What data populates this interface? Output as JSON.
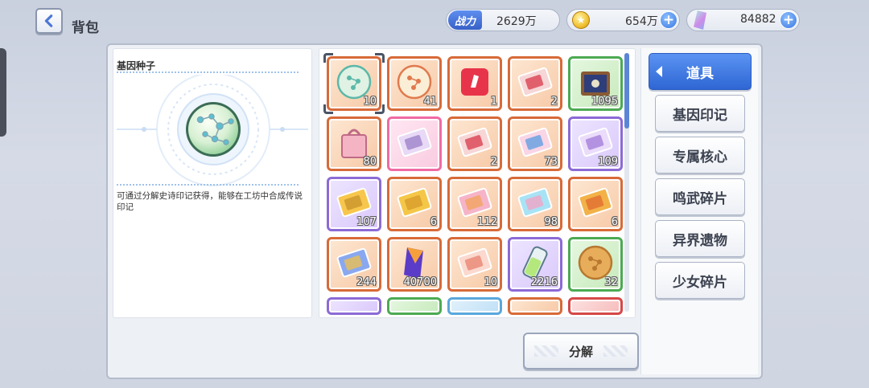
{
  "header": {
    "title": "背包",
    "power_label": "战力",
    "power_value": "2629万",
    "coin_value": "654万",
    "gem_value": "84882",
    "plus": "+"
  },
  "detail": {
    "name": "基因种子",
    "description": "可通过分解史诗印记获得，能够在工坊中合成传说印记"
  },
  "tabs": [
    {
      "label": "道具",
      "active": true
    },
    {
      "label": "基因印记",
      "active": false
    },
    {
      "label": "专属核心",
      "active": false
    },
    {
      "label": "鸣武碎片",
      "active": false
    },
    {
      "label": "异界遗物",
      "active": false
    },
    {
      "label": "少女碎片",
      "active": false
    }
  ],
  "items": [
    {
      "icon": "gene-seed-green-icon",
      "count": "10",
      "rarity": "orange",
      "selected": true
    },
    {
      "icon": "gene-seed-orange-icon",
      "count": "41",
      "rarity": "orange"
    },
    {
      "icon": "red-cube-icon",
      "count": "1",
      "rarity": "orange"
    },
    {
      "icon": "red-ticket-icon",
      "count": "2",
      "rarity": "orange"
    },
    {
      "icon": "treasure-chest-icon",
      "count": "1095",
      "rarity": "green"
    },
    {
      "icon": "gift-box-icon",
      "count": "80",
      "rarity": "orange"
    },
    {
      "icon": "character-card-icon",
      "count": "",
      "rarity": "pink"
    },
    {
      "icon": "red-ticket-small-icon",
      "count": "2",
      "rarity": "orange"
    },
    {
      "icon": "pink-ticket-icon",
      "count": "73",
      "rarity": "orange"
    },
    {
      "icon": "purple-ticket-icon",
      "count": "109",
      "rarity": "purple"
    },
    {
      "icon": "dna-card-gold-icon",
      "count": "107",
      "rarity": "purple"
    },
    {
      "icon": "gold-card-icon",
      "count": "6",
      "rarity": "orange"
    },
    {
      "icon": "dna-card-rainbow-icon",
      "count": "112",
      "rarity": "orange"
    },
    {
      "icon": "rainbow-ticket-icon",
      "count": "98",
      "rarity": "orange"
    },
    {
      "icon": "sword-card-gold-icon",
      "count": "6",
      "rarity": "orange"
    },
    {
      "icon": "sword-card-purple-icon",
      "count": "244",
      "rarity": "orange"
    },
    {
      "icon": "crystal-icon",
      "count": "40700",
      "rarity": "orange"
    },
    {
      "icon": "pig-ticket-icon",
      "count": "10",
      "rarity": "orange"
    },
    {
      "icon": "green-potion-icon",
      "count": "2216",
      "rarity": "purple"
    },
    {
      "icon": "cookie-icon",
      "count": "32",
      "rarity": "green"
    },
    {
      "icon": "item-partial-1-icon",
      "count": "",
      "rarity": "purple"
    },
    {
      "icon": "item-partial-2-icon",
      "count": "",
      "rarity": "green"
    },
    {
      "icon": "item-partial-3-icon",
      "count": "",
      "rarity": "blue"
    },
    {
      "icon": "item-partial-4-icon",
      "count": "",
      "rarity": "orange"
    },
    {
      "icon": "item-partial-5-icon",
      "count": "",
      "rarity": "red"
    }
  ],
  "actions": {
    "decompose": "分解"
  },
  "colors": {
    "accent_blue": "#2f66d4",
    "orange_frame": "#d86a38",
    "purple_frame": "#8c6ad6",
    "green_frame": "#4caa52"
  }
}
